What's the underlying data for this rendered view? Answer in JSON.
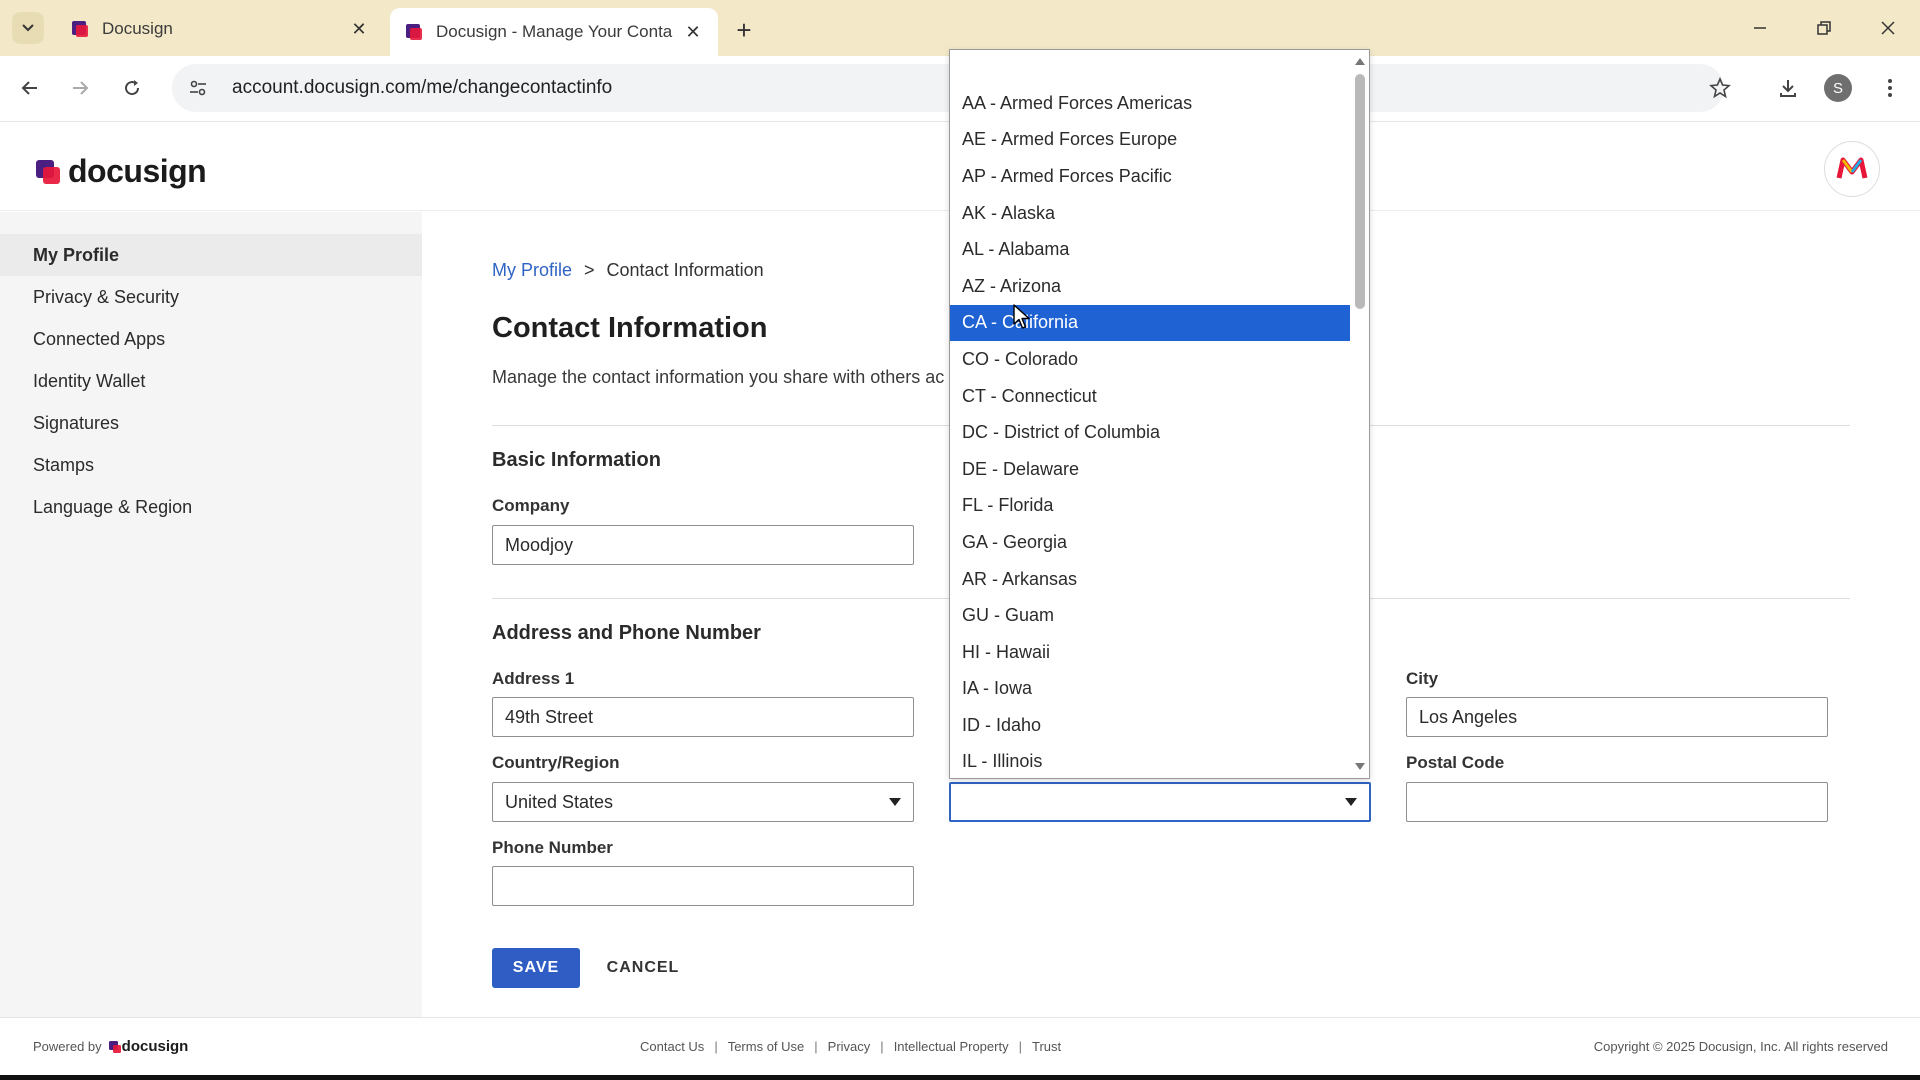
{
  "browser": {
    "tabs": [
      {
        "title": "Docusign",
        "active": false
      },
      {
        "title": "Docusign - Manage Your Conta",
        "active": true
      }
    ],
    "url": "account.docusign.com/me/changecontactinfo",
    "profile_initial": "S"
  },
  "header": {
    "logo_text": "docusign",
    "avatar_letter": "M"
  },
  "sidebar": {
    "items": [
      {
        "label": "My Profile",
        "active": true
      },
      {
        "label": "Privacy & Security"
      },
      {
        "label": "Connected Apps"
      },
      {
        "label": "Identity Wallet"
      },
      {
        "label": "Signatures"
      },
      {
        "label": "Stamps"
      },
      {
        "label": "Language & Region"
      }
    ]
  },
  "main": {
    "breadcrumb": {
      "root": "My Profile",
      "separator": ">",
      "current": "Contact Information"
    },
    "title": "Contact Information",
    "description": "Manage the contact information you share with others ac",
    "basic_section": "Basic Information",
    "company": {
      "label": "Company",
      "value": "Moodjoy"
    },
    "address_section": "Address and Phone Number",
    "address1": {
      "label": "Address 1",
      "value": "49th Street"
    },
    "city": {
      "label": "City",
      "value": "Los Angeles"
    },
    "country": {
      "label": "Country/Region",
      "value": "United States"
    },
    "state": {
      "value": ""
    },
    "postal": {
      "label": "Postal Code",
      "value": ""
    },
    "phone": {
      "label": "Phone Number",
      "value": ""
    },
    "save_label": "SAVE",
    "cancel_label": "CANCEL"
  },
  "state_dropdown": {
    "options": [
      "AA - Armed Forces Americas",
      "AE - Armed Forces Europe",
      "AP - Armed Forces Pacific",
      "AK - Alaska",
      "AL - Alabama",
      "AZ - Arizona",
      "CA - California",
      "CO - Colorado",
      "CT - Connecticut",
      "DC - District of Columbia",
      "DE - Delaware",
      "FL - Florida",
      "GA - Georgia",
      "AR - Arkansas",
      "GU - Guam",
      "HI - Hawaii",
      "IA - Iowa",
      "ID - Idaho",
      "IL - Illinois"
    ],
    "highlighted_index": 6
  },
  "footer": {
    "powered_by": "Powered by",
    "logo_text": "docusign",
    "links": [
      "Contact Us",
      "Terms of Use",
      "Privacy",
      "Intellectual Property",
      "Trust"
    ],
    "copyright": "Copyright © 2025 Docusign, Inc. All rights reserved"
  },
  "colors": {
    "accent": "#2f5dc4",
    "highlight": "#1f62d3",
    "tabbar": "#f3e9c9"
  }
}
